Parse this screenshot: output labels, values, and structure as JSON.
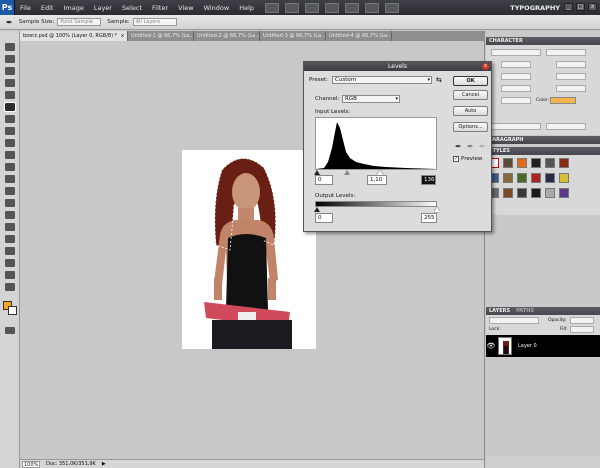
{
  "menubar": {
    "logo": "Ps",
    "items": [
      "File",
      "Edit",
      "Image",
      "Layer",
      "Select",
      "Filter",
      "View",
      "Window",
      "Help"
    ],
    "workspace": "TYPOGRAPHY",
    "min": "_",
    "max": "□",
    "close": "x"
  },
  "options": {
    "sample_size_label": "Sample Size:",
    "sample_size_value": "Point Sample",
    "sample_label": "Sample:",
    "sample_value": "All Layers"
  },
  "tabs": [
    {
      "label": "boerz.psd @ 100% (Layer 0, RGB/8) *",
      "close": "x"
    },
    {
      "label": "Untitled-1 @ 66,7% (La...",
      "close": "x"
    },
    {
      "label": "Untitled-2 @ 66,7% (La...",
      "close": "x"
    },
    {
      "label": "Untitled-3 @ 66,7% (La...",
      "close": "x"
    },
    {
      "label": "Untitled-4 @ 66,7% (La...",
      "close": "x"
    }
  ],
  "status": {
    "zoom": "100%",
    "doc": "Doc: 351,0K/351,9K",
    "arrow": "▶"
  },
  "panels": {
    "character": "CHARACTER",
    "paragraph": "PARAGRAPH",
    "styles": "STYLES",
    "layers": "LAYERS",
    "paths": "PATHS",
    "color_label": "Color:",
    "opacity_label": "Opacity:",
    "fill_label": "Fill:",
    "lock_label": "Lock:",
    "layer_name": "Layer 0"
  },
  "levels": {
    "title": "Levels",
    "close": "x",
    "preset_label": "Preset:",
    "preset_value": "Custom",
    "channel_label": "Channel:",
    "channel_value": "RGB",
    "input_label": "Input Levels:",
    "input_black": "0",
    "input_gamma": "1,10",
    "input_white": "136",
    "output_label": "Output Levels:",
    "output_black": "0",
    "output_white": "255",
    "ok": "OK",
    "cancel": "Cancel",
    "auto": "Auto",
    "options": "Options...",
    "preview": "Preview",
    "preview_checked": true
  },
  "colors": {
    "foreground": "#f6a81c",
    "background": "#ffffff",
    "accent": "#1f5aa6"
  }
}
